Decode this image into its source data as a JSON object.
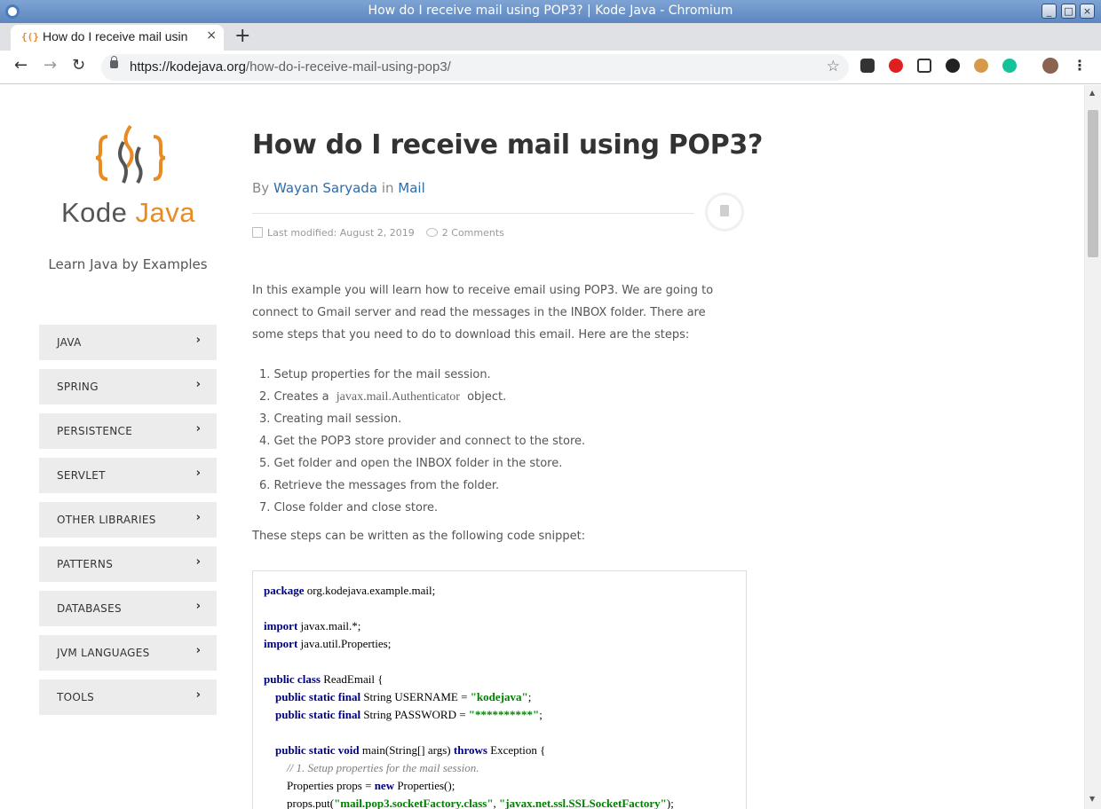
{
  "window": {
    "title": "How do I receive mail using POP3? | Kode Java - Chromium",
    "controls": [
      "_",
      "□",
      "×"
    ]
  },
  "tab": {
    "favicon": "{(}",
    "title": "How do I receive mail usin",
    "close": "×",
    "new_tab": "+"
  },
  "toolbar": {
    "back": "←",
    "forward": "→",
    "reload": "↻",
    "url_host": "https://kodejava.org",
    "url_path": "/how-do-i-receive-mail-using-pop3/",
    "star": "☆",
    "menu": "⋮",
    "extension_icons": [
      "extension-toolbox-icon",
      "extension-adblock-icon",
      "extension-screenshot-icon",
      "extension-spy-icon",
      "extension-cookie-icon",
      "extension-grammarly-icon",
      "profile-avatar-icon"
    ]
  },
  "site": {
    "brand_main": "Kode ",
    "brand_accent": "Java",
    "tagline": "Learn Java by Examples",
    "accent_color": "#e98b23"
  },
  "sidebar": {
    "items": [
      {
        "label": "JAVA"
      },
      {
        "label": "SPRING"
      },
      {
        "label": "PERSISTENCE"
      },
      {
        "label": "SERVLET"
      },
      {
        "label": "OTHER LIBRARIES"
      },
      {
        "label": "PATTERNS"
      },
      {
        "label": "DATABASES"
      },
      {
        "label": "JVM LANGUAGES"
      },
      {
        "label": "TOOLS"
      }
    ],
    "chevron": "›"
  },
  "post": {
    "title": "How do I receive mail using POP3?",
    "by": "By",
    "author": "Wayan Saryada",
    "in": "in",
    "category": "Mail",
    "modified": "Last modified: August 2, 2019",
    "comments": "2 Comments",
    "intro": "In this example you will learn how to receive email using POP3. We are going to connect to Gmail server and read the messages in the INBOX folder. There are some steps that you need to do to download this email. Here are the steps:",
    "steps": [
      "1. Setup properties for the mail session.",
      {
        "before": "2. Creates a ",
        "code": "javax.mail.Authenticator",
        "after": " object."
      },
      "3. Creating mail session.",
      "4. Get the POP3 store provider and connect to the store.",
      "5. Get folder and open the INBOX folder in the store.",
      "6. Retrieve the messages from the folder.",
      "7. Close folder and close store."
    ],
    "outro": "These steps can be written as the following code snippet:"
  },
  "code": {
    "l1_kw": "package",
    "l1": " org.kodejava.example.mail;",
    "l3_kw": "import",
    "l3": " javax.mail.*;",
    "l4_kw": "import",
    "l4": " java.util.Properties;",
    "l6_kw": "public class",
    "l6": " ReadEmail {",
    "l7_kw": "public static final",
    "l7a": " String USERNAME = ",
    "l7_str": "\"kodejava\"",
    "l7b": ";",
    "l8_kw": "public static final",
    "l8a": " String PASSWORD = ",
    "l8_str": "\"**********\"",
    "l8b": ";",
    "l10_kw": "public static void",
    "l10a": " main(String[] args) ",
    "l10_kw2": "throws",
    "l10b": " Exception {",
    "l11_cmt": "// 1. Setup properties for the mail session.",
    "l12a": "Properties props = ",
    "l12_kw": "new",
    "l12b": " Properties();",
    "l13a": "props.put(",
    "l13_str1": "\"mail.pop3.socketFactory.class\"",
    "l13b": ", ",
    "l13_str2": "\"javax.net.ssl.SSLSocketFactory\"",
    "l13c": ");"
  }
}
